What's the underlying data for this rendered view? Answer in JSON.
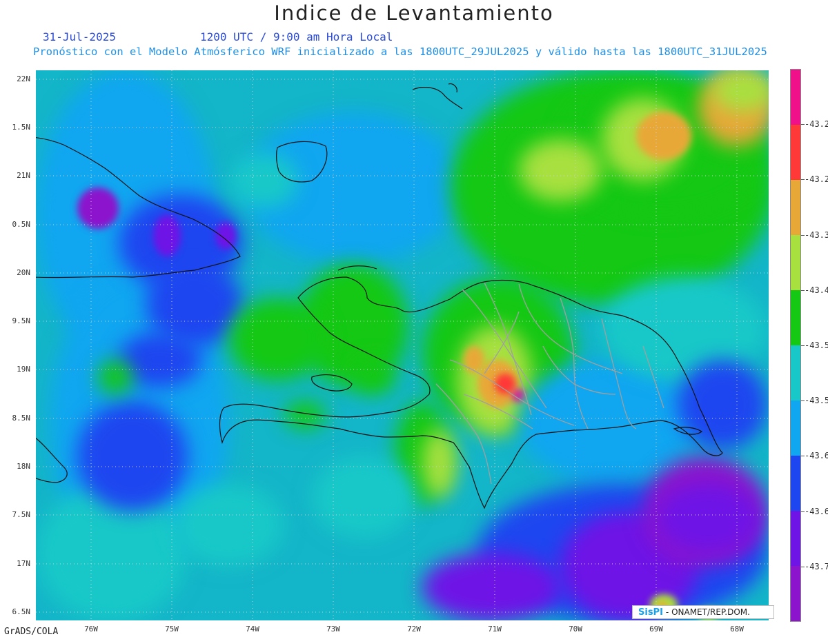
{
  "header": {
    "title": "Indice de Levantamiento",
    "date": "31-Jul-2025",
    "time": "1200 UTC / 9:00 am Hora Local",
    "init": "Pronóstico con el Modelo Atmósferico WRF inicializado a las 1800UTC_29JUL2025 y válido hasta las  1800UTC_31JUL2025"
  },
  "map": {
    "lat_labels": [
      "22N",
      "1.5N",
      "21N",
      "0.5N",
      "20N",
      "9.5N",
      "19N",
      "8.5N",
      "18N",
      "7.5N",
      "17N",
      "6.5N"
    ],
    "lon_labels": [
      "76W",
      "75W",
      "74W",
      "73W",
      "72W",
      "71W",
      "70W",
      "69W",
      "68W"
    ]
  },
  "legend": {
    "colors": [
      "#f0108a",
      "#ff3838",
      "#e8a838",
      "#a8e040",
      "#14c814",
      "#18c8c8",
      "#10a6f0",
      "#1e46f0",
      "#6e14e6",
      "#8c14cc"
    ],
    "labels": [
      "-43.2",
      "-43.2",
      "-43.3",
      "-43.4",
      "-43.5",
      "-43.5",
      "-43.6",
      "-43.6",
      "-43.7"
    ]
  },
  "credit": {
    "logo": "SisPI",
    "text": "- ONAMET/REP.DOM."
  },
  "footer": {
    "software": "GrADS/COLA"
  }
}
